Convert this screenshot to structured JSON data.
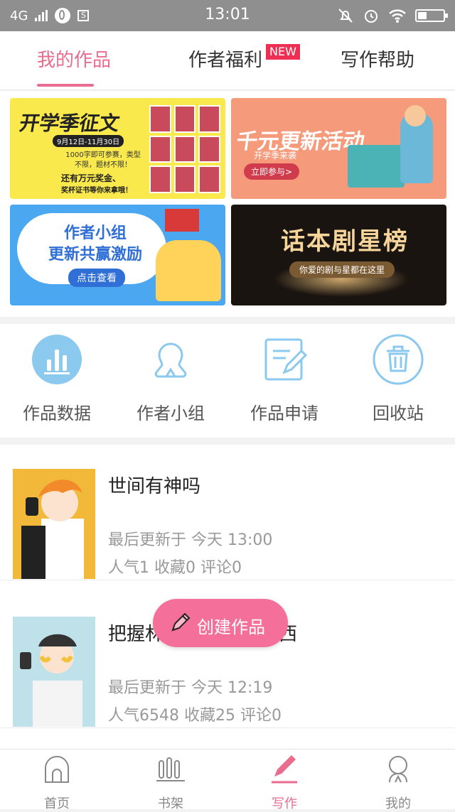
{
  "status_bar": {
    "network": "4G",
    "time": "13:01",
    "s_icon": "S"
  },
  "tabs": [
    {
      "label": "我的作品",
      "active": true
    },
    {
      "label": "作者福利",
      "badge": "NEW"
    },
    {
      "label": "写作帮助"
    }
  ],
  "banners": [
    {
      "title": "开学季征文",
      "date": "9月12日-11月30日",
      "text": "1000字即可参赛，类型不限，题材不限！",
      "gift_line1": "还有万元奖金、",
      "gift_line2": "奖杯证书等你来拿哦！"
    },
    {
      "title": "千元更新活动",
      "subtitle": "开学季来袭",
      "button": "立即参与>"
    },
    {
      "title_line1": "作者小组",
      "title_line2": "更新共赢激励",
      "button": "点击查看"
    },
    {
      "title": "话本剧星榜",
      "subtitle": "你爱的剧与星都在这里"
    }
  ],
  "shortcuts": [
    {
      "label": "作品数据",
      "icon": "bar-chart-icon"
    },
    {
      "label": "作者小组",
      "icon": "group-icon"
    },
    {
      "label": "作品申请",
      "icon": "edit-doc-icon"
    },
    {
      "label": "回收站",
      "icon": "trash-icon"
    }
  ],
  "works": [
    {
      "title": "世间有神吗",
      "updated": "最后更新于 今天 13:00",
      "stats": "人气1 收藏0 评论0"
    },
    {
      "title": "把握林",
      "title_end": "西",
      "updated": "最后更新于 今天 12:19",
      "stats": "人气6548 收藏25 评论0"
    }
  ],
  "fab": {
    "label": "创建作品"
  },
  "bottom_nav": [
    {
      "label": "首页",
      "icon": "home-icon"
    },
    {
      "label": "书架",
      "icon": "bookshelf-icon"
    },
    {
      "label": "写作",
      "icon": "pen-icon",
      "active": true
    },
    {
      "label": "我的",
      "icon": "profile-icon"
    }
  ],
  "colors": {
    "accent": "#e96d8f",
    "fab": "#f56f9b",
    "badge": "#ee2e53"
  }
}
